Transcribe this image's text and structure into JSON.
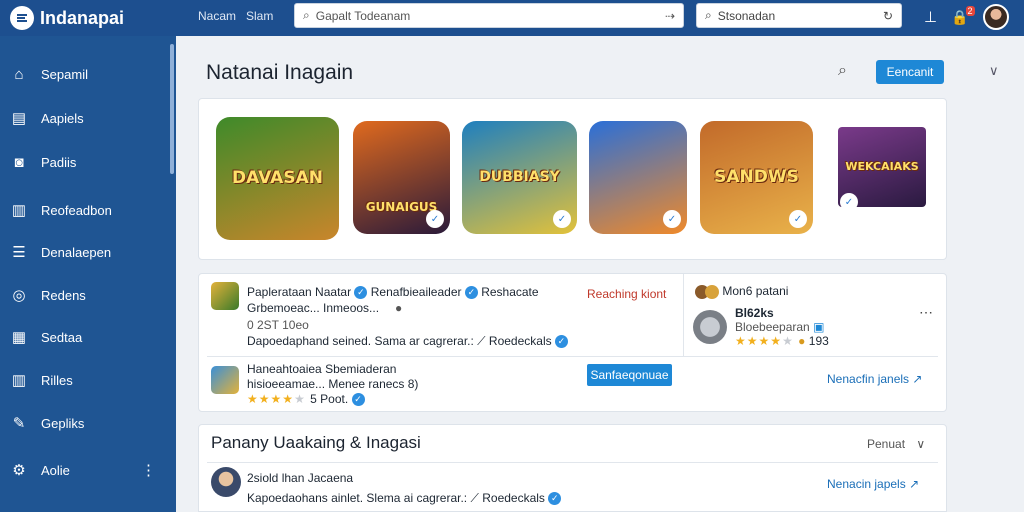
{
  "app": {
    "brand": "Indanapai"
  },
  "topbar": {
    "links": [
      "Nacam",
      "Slam"
    ],
    "search1_placeholder": "Gapalt Todeanam",
    "search2_placeholder": "Stsonadan",
    "notif_count": "2"
  },
  "sidebar": {
    "items": [
      {
        "label": "Sepamil",
        "icon": "home-icon"
      },
      {
        "label": "Aapiels",
        "icon": "card-icon"
      },
      {
        "label": "Padiis",
        "icon": "chat-icon"
      },
      {
        "label": "Reofeadbon",
        "icon": "chart-icon"
      },
      {
        "label": "Denalaepen",
        "icon": "list-icon"
      },
      {
        "label": "Redens",
        "icon": "globe-icon"
      },
      {
        "label": "Sedtaa",
        "icon": "grid-icon"
      },
      {
        "label": "Rilles",
        "icon": "columns-icon"
      },
      {
        "label": "Gepliks",
        "icon": "puzzle-icon"
      },
      {
        "label": "Aolie",
        "icon": "gear-icon"
      }
    ]
  },
  "header": {
    "title": "Natanai  Inagain",
    "button": "Eencanit"
  },
  "games": [
    {
      "title": "DAVASAN",
      "colors": [
        "#3e8a2a",
        "#c9862b"
      ]
    },
    {
      "title": "GUNAIGUS",
      "colors": [
        "#2a1a3a",
        "#e06a1e"
      ]
    },
    {
      "title": "DUBBIASY",
      "colors": [
        "#1e7fbf",
        "#e3c23a"
      ]
    },
    {
      "title": "",
      "colors": [
        "#2a6fd8",
        "#f08a2a"
      ]
    },
    {
      "title": "SANDWS",
      "colors": [
        "#c26a2a",
        "#e9b24a"
      ]
    },
    {
      "title": "WEKCAIAKS",
      "colors": [
        "#2a1a40",
        "#7a3a8a"
      ]
    }
  ],
  "reviews": {
    "r1": {
      "title": "Paplerataan Naatar",
      "tag": "Renafbieaileader",
      "extra": "Reshacate",
      "line2": "Grbemoeac... Inmeoos...",
      "meta": "0 2ST 10eo",
      "desc": "Dapoedaphand seined. Sama ar cagrerar.:",
      "link": "Roedeckals",
      "flag": "Reaching kiont"
    },
    "r2": {
      "title": "Haneahtoaiea",
      "sub": "Sbemiaderan",
      "line2": "hisioeeamae... Menee ranecs 8)",
      "rating_value": 4,
      "meta": "5 Poot.",
      "button": "Sanfaeqonuae",
      "link": "Nenacfin janels"
    },
    "side": {
      "title": "Mon6",
      "sub": "patani",
      "handle": "Bl62ks",
      "desc": "Bloebeeparan",
      "rating_value": 4,
      "count": "193"
    }
  },
  "section2": {
    "title": "Panany Uaakaing & Inagasi",
    "sort_label": "Penuat",
    "item": {
      "title": "2siold",
      "sub": "lhan Jacaena",
      "desc": "Kapoedaohans ainlet. Slema ai cagrerar.:",
      "link": "Roedeckals",
      "action": "Nenacin japels"
    }
  }
}
